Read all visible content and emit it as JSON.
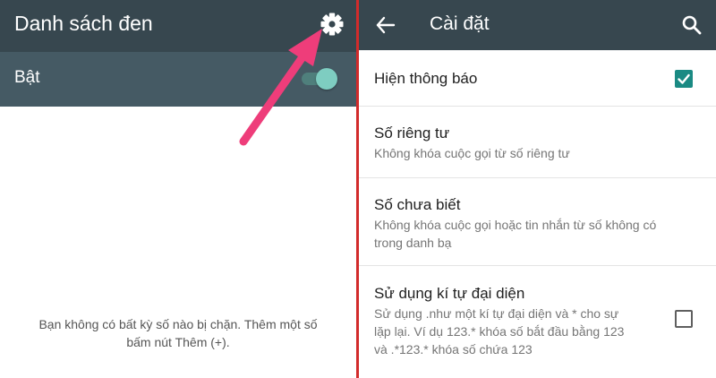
{
  "left": {
    "title": "Danh sách đen",
    "toggle_label": "Bật",
    "toggle_on": true,
    "empty_message_lines": [
      "Bạn không có bất kỳ số nào bị chặn. Thêm một số",
      "bấm nút Thêm (+)."
    ]
  },
  "right": {
    "title": "Cài đặt",
    "settings": [
      {
        "title": "Hiện thông báo",
        "checked": true
      },
      {
        "title": "Số riêng tư",
        "subtitle_lines": [
          "Không khóa cuộc gọi từ số riêng tư"
        ]
      },
      {
        "title": "Số chưa biết",
        "subtitle_lines": [
          "Không khóa cuộc gọi hoặc tin nhắn từ số không có",
          "trong danh bạ"
        ]
      },
      {
        "title": "Sử dụng kí tự đại diện",
        "checked": false,
        "subtitle_lines": [
          "Sử dụng .như một kí tự đại diện và * cho sự",
          "lặp lại. Ví dụ 123.* khóa số bắt đầu bằng 123",
          "và .*123.* khóa số chứa 123"
        ]
      }
    ]
  },
  "icons": {
    "settings": "gear-icon",
    "back": "arrow-left-icon",
    "search": "search-icon",
    "annotation": "pointer-arrow-icon"
  },
  "colors": {
    "toolbar": "#37474f",
    "subbar": "#455a64",
    "accent": "#1a8a83",
    "annotation": "#ee3d7a",
    "divider": "#d22b2b"
  }
}
